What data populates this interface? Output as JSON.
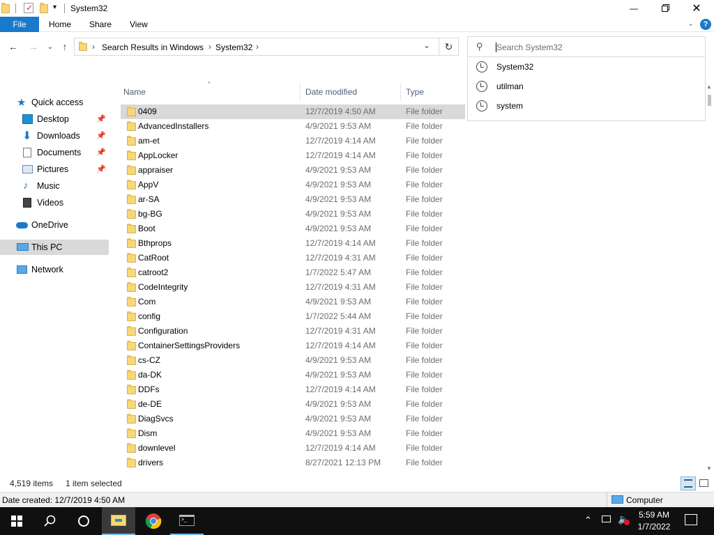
{
  "window": {
    "title": "System32",
    "controls": {
      "minimize": "—",
      "maximize": "❐",
      "close": "✕"
    }
  },
  "ribbon": {
    "tabs": [
      {
        "label": "File"
      },
      {
        "label": "Home"
      },
      {
        "label": "Share"
      },
      {
        "label": "View"
      }
    ]
  },
  "address": {
    "crumbs": [
      "Search Results in Windows",
      "System32"
    ]
  },
  "search": {
    "placeholder": "Search System32",
    "suggestions": [
      "System32",
      "utilman",
      "system"
    ]
  },
  "navpane": {
    "quick_access": "Quick access",
    "items": [
      {
        "label": "Desktop",
        "icon": "desktop-icon",
        "pinned": true
      },
      {
        "label": "Downloads",
        "icon": "downloads-icon",
        "pinned": true
      },
      {
        "label": "Documents",
        "icon": "documents-icon",
        "pinned": true
      },
      {
        "label": "Pictures",
        "icon": "pictures-icon",
        "pinned": true
      },
      {
        "label": "Music",
        "icon": "music-icon",
        "pinned": false
      },
      {
        "label": "Videos",
        "icon": "videos-icon",
        "pinned": false
      }
    ],
    "onedrive": "OneDrive",
    "this_pc": "This PC",
    "network": "Network"
  },
  "list": {
    "columns": {
      "name": "Name",
      "date": "Date modified",
      "type": "Type"
    },
    "rows": [
      {
        "name": "0409",
        "date": "12/7/2019 4:50 AM",
        "type": "File folder",
        "selected": true
      },
      {
        "name": "AdvancedInstallers",
        "date": "4/9/2021 9:53 AM",
        "type": "File folder"
      },
      {
        "name": "am-et",
        "date": "12/7/2019 4:14 AM",
        "type": "File folder"
      },
      {
        "name": "AppLocker",
        "date": "12/7/2019 4:14 AM",
        "type": "File folder"
      },
      {
        "name": "appraiser",
        "date": "4/9/2021 9:53 AM",
        "type": "File folder"
      },
      {
        "name": "AppV",
        "date": "4/9/2021 9:53 AM",
        "type": "File folder"
      },
      {
        "name": "ar-SA",
        "date": "4/9/2021 9:53 AM",
        "type": "File folder"
      },
      {
        "name": "bg-BG",
        "date": "4/9/2021 9:53 AM",
        "type": "File folder"
      },
      {
        "name": "Boot",
        "date": "4/9/2021 9:53 AM",
        "type": "File folder"
      },
      {
        "name": "Bthprops",
        "date": "12/7/2019 4:14 AM",
        "type": "File folder"
      },
      {
        "name": "CatRoot",
        "date": "12/7/2019 4:31 AM",
        "type": "File folder"
      },
      {
        "name": "catroot2",
        "date": "1/7/2022 5:47 AM",
        "type": "File folder"
      },
      {
        "name": "CodeIntegrity",
        "date": "12/7/2019 4:31 AM",
        "type": "File folder"
      },
      {
        "name": "Com",
        "date": "4/9/2021 9:53 AM",
        "type": "File folder"
      },
      {
        "name": "config",
        "date": "1/7/2022 5:44 AM",
        "type": "File folder"
      },
      {
        "name": "Configuration",
        "date": "12/7/2019 4:31 AM",
        "type": "File folder"
      },
      {
        "name": "ContainerSettingsProviders",
        "date": "12/7/2019 4:14 AM",
        "type": "File folder"
      },
      {
        "name": "cs-CZ",
        "date": "4/9/2021 9:53 AM",
        "type": "File folder"
      },
      {
        "name": "da-DK",
        "date": "4/9/2021 9:53 AM",
        "type": "File folder"
      },
      {
        "name": "DDFs",
        "date": "12/7/2019 4:14 AM",
        "type": "File folder"
      },
      {
        "name": "de-DE",
        "date": "4/9/2021 9:53 AM",
        "type": "File folder"
      },
      {
        "name": "DiagSvcs",
        "date": "4/9/2021 9:53 AM",
        "type": "File folder"
      },
      {
        "name": "Dism",
        "date": "4/9/2021 9:53 AM",
        "type": "File folder"
      },
      {
        "name": "downlevel",
        "date": "12/7/2019 4:14 AM",
        "type": "File folder"
      },
      {
        "name": "drivers",
        "date": "8/27/2021 12:13 PM",
        "type": "File folder"
      }
    ]
  },
  "status": {
    "item_count": "4,519 items",
    "selected": "1 item selected"
  },
  "details": {
    "date_created": "Date created: 12/7/2019 4:50 AM",
    "location": "Computer"
  },
  "taskbar": {
    "time": "5:59 AM",
    "date": "1/7/2022"
  },
  "colors": {
    "accent": "#1979ca",
    "selection": "#d9d9d9",
    "folder": "#f8d775",
    "taskbar": "#101010"
  }
}
